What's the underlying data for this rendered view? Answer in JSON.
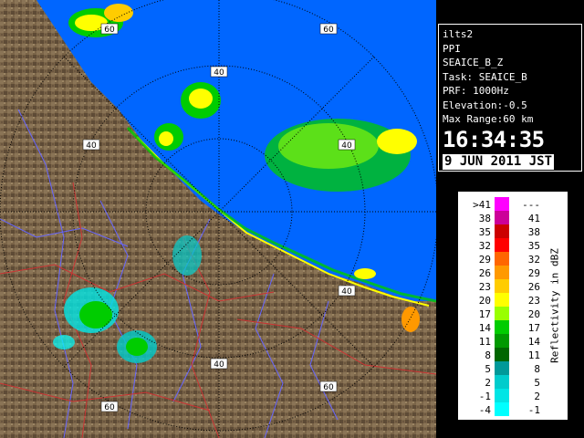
{
  "info": {
    "site": "ilts2",
    "product": "PPI",
    "name": "SEAICE_B_Z",
    "task": "Task: SEAICE_B",
    "prf": "PRF: 1000Hz",
    "elevation": "Elevation:-0.5",
    "max_range": "Max Range:60 km",
    "time": "16:34:35",
    "date": "9 JUN 2011 JST"
  },
  "range_rings": {
    "labels": [
      "40",
      "60"
    ],
    "ring_40": "40",
    "ring_60": "60"
  },
  "legend": {
    "title": "Reflectivity in dBZ",
    "rows": [
      {
        "lo": ">41",
        "hi": "---",
        "color": "#ff00ff"
      },
      {
        "lo": "38",
        "hi": "41",
        "color": "#cc0099"
      },
      {
        "lo": "35",
        "hi": "38",
        "color": "#cc0000"
      },
      {
        "lo": "32",
        "hi": "35",
        "color": "#ff0000"
      },
      {
        "lo": "29",
        "hi": "32",
        "color": "#ff6600"
      },
      {
        "lo": "26",
        "hi": "29",
        "color": "#ff9900"
      },
      {
        "lo": "23",
        "hi": "26",
        "color": "#ffcc00"
      },
      {
        "lo": "20",
        "hi": "23",
        "color": "#ffff00"
      },
      {
        "lo": "17",
        "hi": "20",
        "color": "#99ff00"
      },
      {
        "lo": "14",
        "hi": "17",
        "color": "#00cc00"
      },
      {
        "lo": "11",
        "hi": "14",
        "color": "#009900"
      },
      {
        "lo": "8",
        "hi": "11",
        "color": "#006600"
      },
      {
        "lo": "5",
        "hi": "8",
        "color": "#009999"
      },
      {
        "lo": "2",
        "hi": "5",
        "color": "#00cccc"
      },
      {
        "lo": "-1",
        "hi": "2",
        "color": "#00e5e5"
      },
      {
        "lo": "-4",
        "hi": "-1",
        "color": "#00ffff"
      }
    ]
  },
  "colors": {
    "sea": "#0066ff",
    "land": "#7a6448",
    "rivers": "#6666ff",
    "borders": "#cc3333"
  }
}
